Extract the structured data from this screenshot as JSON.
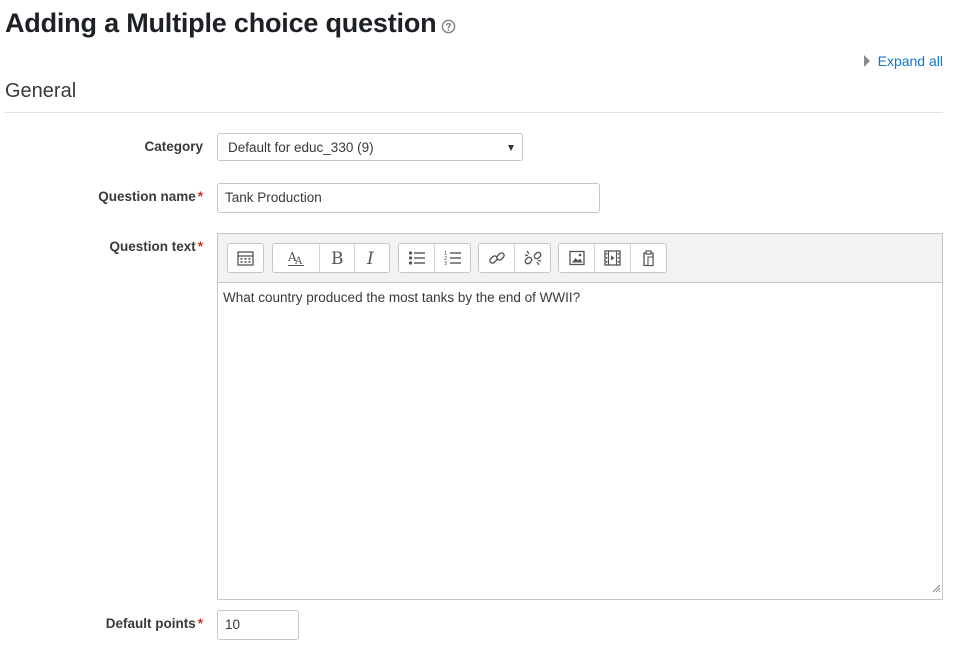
{
  "page": {
    "title": "Adding a Multiple choice question",
    "help_icon": "question-circle-icon",
    "expand_all": "Expand all"
  },
  "section": {
    "title": "General"
  },
  "form": {
    "category": {
      "label": "Category",
      "value": "Default for educ_330 (9)"
    },
    "question_name": {
      "label": "Question name",
      "value": "Tank Production",
      "required": true
    },
    "question_text": {
      "label": "Question text",
      "value": "What country produced the most tanks by the end of WWII?",
      "required": true,
      "toolbar": [
        [
          "toolbar-toggle-icon"
        ],
        [
          "font-style-icon",
          "bold-icon",
          "italic-icon"
        ],
        [
          "unordered-list-icon",
          "ordered-list-icon"
        ],
        [
          "link-icon",
          "unlink-icon"
        ],
        [
          "image-icon",
          "media-icon",
          "manage-files-icon"
        ]
      ]
    },
    "default_points": {
      "label": "Default points",
      "value": "10",
      "required": true
    },
    "required_marker": "*"
  },
  "colors": {
    "link": "#1177d1",
    "required": "#ca3120",
    "border": "#c4c8cc",
    "toolbar_bg": "#f2f2f2"
  }
}
